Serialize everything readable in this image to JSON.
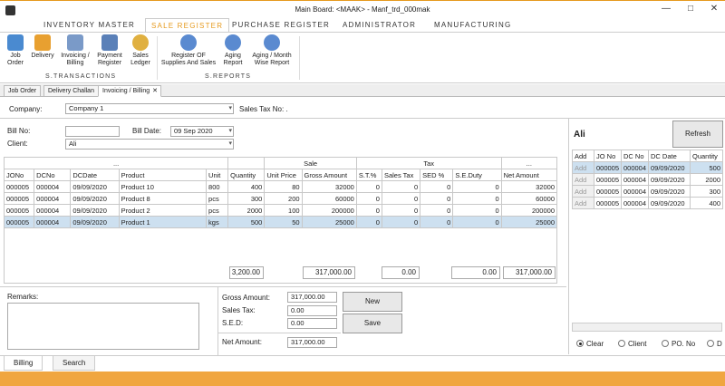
{
  "window": {
    "title": "Main Board: <MAAK> - Manf_trd_000mak",
    "min": "—",
    "max": "□",
    "close": "✕"
  },
  "ribbon_tabs": [
    "INVENTORY MASTER",
    "SALE REGISTER",
    "PURCHASE REGISTER",
    "ADMINISTRATOR",
    "MANUFACTURING"
  ],
  "ribbon": {
    "transactions": [
      "Job Order",
      "Delivery",
      "Invoicing / Billing",
      "Payment Register",
      "Sales Ledger"
    ],
    "transactions_label": "S.TRANSACTIONS",
    "reports": [
      "Register OF Supplies And Sales",
      "Aging Report",
      "Aging / Month Wise Report"
    ],
    "reports_label": "S.REPORTS"
  },
  "doc_tabs": [
    "Job Order",
    "Delivery Challan",
    "Invoicing / Billing"
  ],
  "doc_tab_close": "✕",
  "form": {
    "company_label": "Company:",
    "company_value": "Company 1",
    "sales_tax_label": "Sales Tax No: .",
    "bill_no_label": "Bill No:",
    "bill_no_value": "",
    "bill_date_label": "Bill Date:",
    "bill_date_value": "09 Sep 2020",
    "client_label": "Client:",
    "client_value": "Ali"
  },
  "grid": {
    "groups": [
      "...",
      "Sale",
      "Tax",
      "..."
    ],
    "headers": [
      "JONo",
      "DCNo",
      "DCDate",
      "Product",
      "Unit",
      "Quantity",
      "Unit Price",
      "Gross Amount",
      "S.T.%",
      "Sales Tax",
      "SED %",
      "S.E.Duty",
      "Net Amount"
    ],
    "rows": [
      [
        "000005",
        "000004",
        "09/09/2020",
        "Product 10",
        "800",
        "400",
        "80",
        "32000",
        "0",
        "0",
        "0",
        "0",
        "32000"
      ],
      [
        "000005",
        "000004",
        "09/09/2020",
        "Product 8",
        "pcs",
        "300",
        "200",
        "60000",
        "0",
        "0",
        "0",
        "0",
        "60000"
      ],
      [
        "000005",
        "000004",
        "09/09/2020",
        "Product 2",
        "pcs",
        "2000",
        "100",
        "200000",
        "0",
        "0",
        "0",
        "0",
        "200000"
      ],
      [
        "000005",
        "000004",
        "09/09/2020",
        "Product 1",
        "kgs",
        "500",
        "50",
        "25000",
        "0",
        "0",
        "0",
        "0",
        "25000"
      ]
    ],
    "totals": {
      "quantity": "3,200.00",
      "gross": "317,000.00",
      "sales_tax": "0.00",
      "sed": "0.00",
      "net": "317,000.00"
    }
  },
  "remarks_label": "Remarks:",
  "summary": {
    "gross_label": "Gross Amount:",
    "gross": "317,000.00",
    "tax_label": "Sales Tax:",
    "tax": "0.00",
    "sed_label": "S.E.D:",
    "sed": "0.00",
    "net_label": "Net Amount:",
    "net": "317,000.00"
  },
  "buttons": {
    "new": "New",
    "save": "Save",
    "refresh": "Refresh"
  },
  "right_panel": {
    "client_name": "Ali",
    "headers": [
      "Add",
      "JO No",
      "DC No",
      "DC Date",
      "Quantity"
    ],
    "rows": [
      [
        "Add",
        "000005",
        "000004",
        "09/09/2020",
        "500"
      ],
      [
        "Add",
        "000005",
        "000004",
        "09/09/2020",
        "2000"
      ],
      [
        "Add",
        "000005",
        "000004",
        "09/09/2020",
        "300"
      ],
      [
        "Add",
        "000005",
        "000004",
        "09/09/2020",
        "400"
      ]
    ],
    "radios": [
      "Clear",
      "Client",
      "PO. No",
      "D"
    ]
  },
  "bottom_tabs": [
    "Billing",
    "Search"
  ],
  "colors": {
    "accent": "#e69a1e",
    "status": "#f0a640",
    "selected": "#cde0f0"
  }
}
